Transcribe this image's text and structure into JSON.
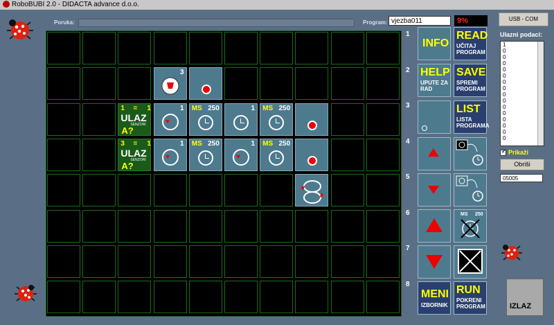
{
  "window": {
    "title": "RoboBUBI 2.0 - DIDACTA advance d.o.o."
  },
  "header": {
    "poruka_label": "Poruka:",
    "poruka_value": "",
    "program_label": "Program:",
    "program_value": "vjezba011",
    "progress_text": "9%",
    "usb_button": "USB - COM"
  },
  "grid": {
    "rows": 8,
    "cols": 10,
    "cells": [
      {
        "name": "cell-light-sensor",
        "col": 3,
        "row": 1,
        "kind": "lamp",
        "num": "3"
      },
      {
        "name": "cell-stop-dot",
        "col": 4,
        "row": 1,
        "kind": "dot"
      },
      {
        "name": "cell-input-1",
        "col": 2,
        "row": 2,
        "kind": "ulaz",
        "a": "1",
        "eq": "=",
        "b": "1",
        "word": "ULAZ",
        "sub": "SENZORI",
        "q": "A?"
      },
      {
        "name": "cell-wheel-1",
        "col": 3,
        "row": 2,
        "kind": "wheel",
        "num": "1"
      },
      {
        "name": "cell-timer-250-a",
        "col": 4,
        "row": 2,
        "kind": "clock",
        "ms": "MS",
        "num": "250"
      },
      {
        "name": "cell-wheel-1b",
        "col": 5,
        "row": 2,
        "kind": "clock",
        "num": "1"
      },
      {
        "name": "cell-timer-250-b",
        "col": 6,
        "row": 2,
        "kind": "clock",
        "ms": "MS",
        "num": "250"
      },
      {
        "name": "cell-stop-dot-2",
        "col": 7,
        "row": 2,
        "kind": "dot"
      },
      {
        "name": "cell-input-3",
        "col": 2,
        "row": 3,
        "kind": "ulaz",
        "a": "3",
        "eq": "=",
        "b": "1",
        "word": "ULAZ",
        "sub": "SENZORI",
        "q": "A?"
      },
      {
        "name": "cell-gauge-1",
        "col": 3,
        "row": 3,
        "kind": "wheel",
        "num": "1"
      },
      {
        "name": "cell-timer-250-c",
        "col": 4,
        "row": 3,
        "kind": "clock",
        "ms": "MS",
        "num": "250"
      },
      {
        "name": "cell-wheel-1c",
        "col": 5,
        "row": 3,
        "kind": "wheel",
        "num": "1"
      },
      {
        "name": "cell-timer-250-d",
        "col": 6,
        "row": 3,
        "kind": "clock",
        "ms": "MS",
        "num": "250"
      },
      {
        "name": "cell-stop-dot-3",
        "col": 7,
        "row": 3,
        "kind": "dot"
      },
      {
        "name": "cell-loop",
        "col": 7,
        "row": 4,
        "kind": "loop"
      }
    ]
  },
  "row_numbers": [
    "1",
    "2",
    "3",
    "4",
    "5",
    "6",
    "7",
    "8"
  ],
  "palette": {
    "info": "INFO",
    "help": "HELP",
    "help_sub": "UPUTE ZA RAD",
    "read": "READ",
    "read_sub": "UČITAJ PROGRAM",
    "save": "SAVE",
    "save_sub": "SPREMI PROGRAM",
    "list": "LIST",
    "list_sub": "LISTA PROGRAMA",
    "ms": "MS",
    "ms_num": "250",
    "meni": "MENI",
    "meni_sub": "IZBORNIK",
    "run": "RUN",
    "run_sub": "POKRENI PROGRAM"
  },
  "sidebar": {
    "title": "Ulazni podaci:",
    "inputs": [
      "1",
      "0",
      "0",
      "0",
      "0",
      "0",
      "0",
      "0",
      "0",
      "0",
      "0",
      "0",
      "0",
      "0",
      "0",
      "0"
    ],
    "checkbox_label": "Prikaži",
    "checkbox_checked": true,
    "clear_button": "Obriši",
    "code_value": "05005",
    "exit_button": "IZLAZ"
  },
  "colors": {
    "background": "#5a6f85",
    "tile": "#4e7a8e",
    "input_tile": "#1a5a1a",
    "label_yellow": "#ffff00",
    "stop_red": "#e00000"
  }
}
